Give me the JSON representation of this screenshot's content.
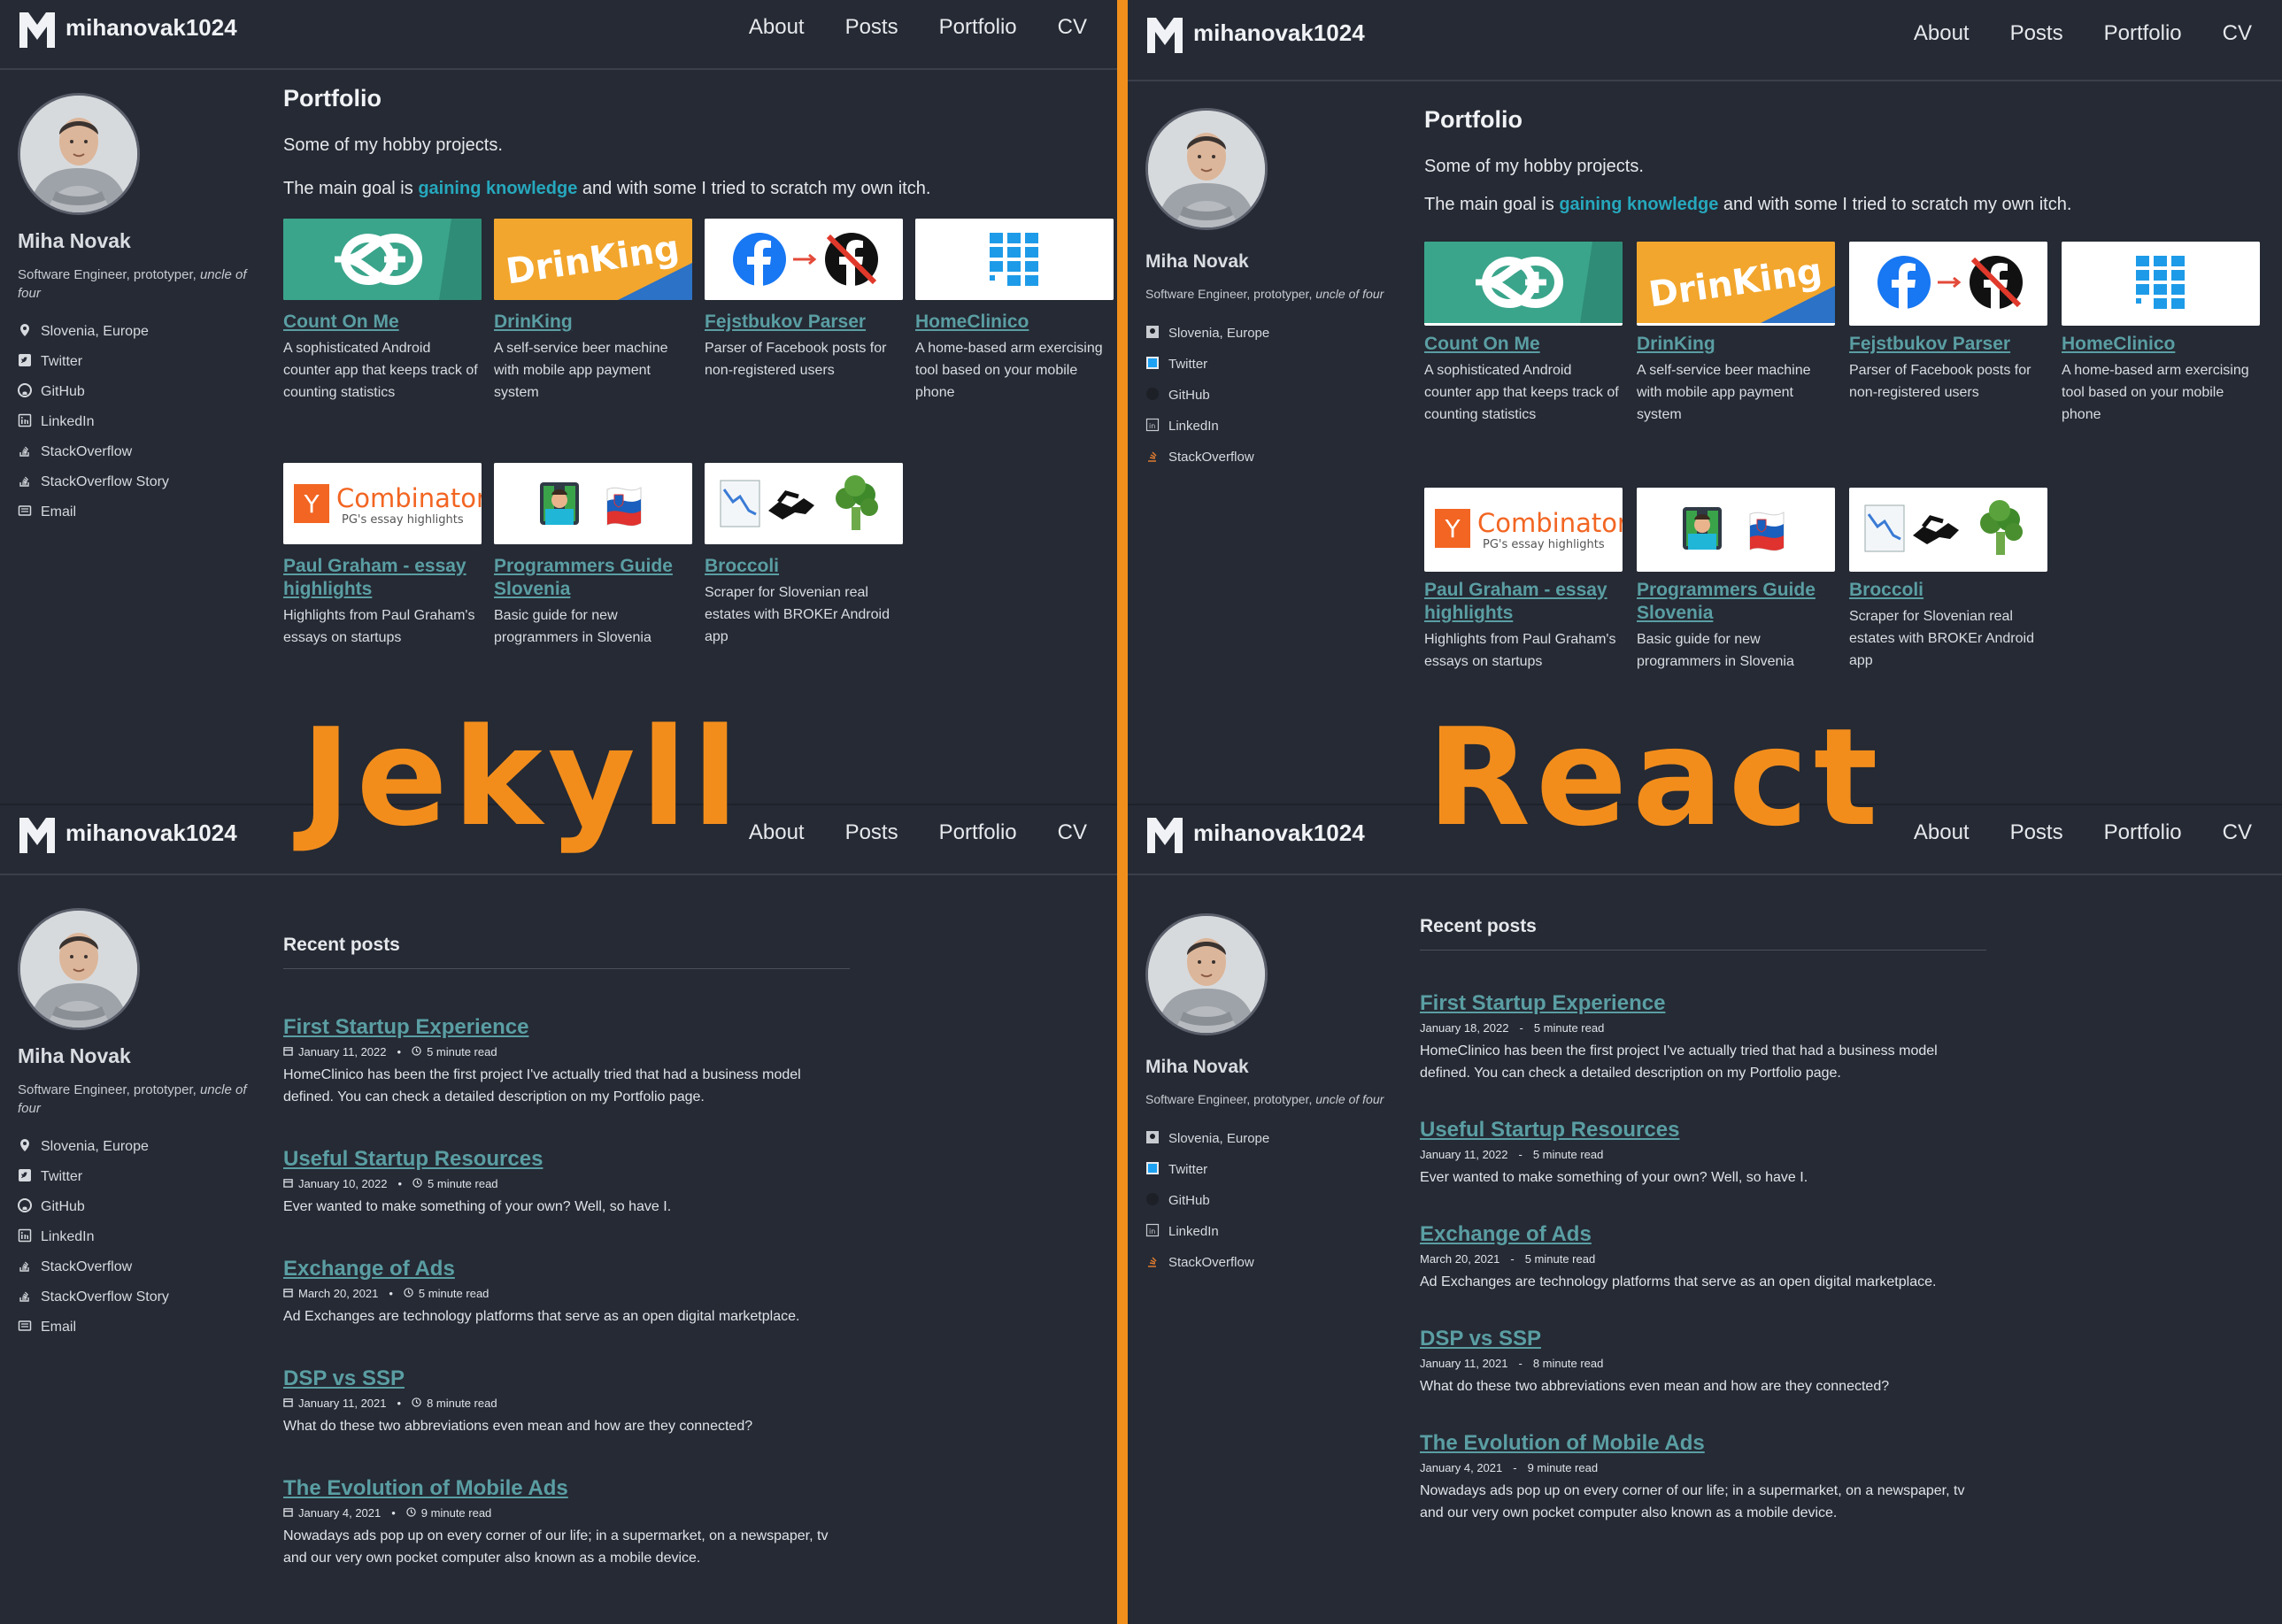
{
  "overlay": {
    "left_label": "Jekyll",
    "right_label": "React"
  },
  "brand": {
    "name": "mihanovak1024"
  },
  "nav": [
    "About",
    "Posts",
    "Portfolio",
    "CV"
  ],
  "profile": {
    "name": "Miha Novak",
    "tagline_prefix": "Software Engineer, prototyper,",
    "tagline_italic": "uncle of four"
  },
  "sidebar_links_jekyll": [
    {
      "label": "Slovenia, Europe",
      "icon": "map-pin-icon"
    },
    {
      "label": "Twitter",
      "icon": "twitter-icon"
    },
    {
      "label": "GitHub",
      "icon": "github-icon"
    },
    {
      "label": "LinkedIn",
      "icon": "linkedin-icon"
    },
    {
      "label": "StackOverflow",
      "icon": "stackoverflow-icon"
    },
    {
      "label": "StackOverflow Story",
      "icon": "stackoverflow-icon"
    },
    {
      "label": "Email",
      "icon": "email-icon"
    }
  ],
  "sidebar_links_react": [
    {
      "label": "Slovenia, Europe",
      "icon": "map-pin-icon"
    },
    {
      "label": "Twitter",
      "icon": "twitter-icon"
    },
    {
      "label": "GitHub",
      "icon": "github-icon"
    },
    {
      "label": "LinkedIn",
      "icon": "linkedin-icon"
    },
    {
      "label": "StackOverflow",
      "icon": "stackoverflow-icon"
    }
  ],
  "portfolio": {
    "title": "Portfolio",
    "intro": "Some of my hobby projects.",
    "goal_prefix": "The main goal is",
    "goal_highlight": "gaining knowledge",
    "goal_suffix": "and with some I tried to scratch my own itch.",
    "projects": [
      {
        "title": "Count On Me",
        "desc": "A sophisticated Android counter app that keeps track of counting statistics",
        "thumb": "count-on-me"
      },
      {
        "title": "DrinKing",
        "desc": "A self-service beer machine with mobile app payment system",
        "thumb": "drinking"
      },
      {
        "title": "Fejstbukov Parser",
        "desc": "Parser of Facebook posts for non-registered users",
        "thumb": "facebook-parser"
      },
      {
        "title": "HomeClinico",
        "desc": "A home-based arm exercising tool based on your mobile phone",
        "thumb": "homeclinico"
      },
      {
        "title": "Paul Graham - essay highlights",
        "desc": "Highlights from Paul Graham's essays on startups",
        "thumb": "ycombinator"
      },
      {
        "title": "Programmers Guide Slovenia",
        "desc": "Basic guide for new programmers in Slovenia",
        "thumb": "programmer-slovenia"
      },
      {
        "title": "Broccoli",
        "desc": "Scraper for Slovenian real estates with BROKEr Android app",
        "thumb": "broccoli"
      }
    ],
    "thumb_text": {
      "drinking": "DrinKing",
      "yc_name": "Combinator",
      "yc_sub": "PG's essay highlights",
      "yc_letter": "Y"
    }
  },
  "posts": {
    "heading": "Recent posts",
    "jekyll": [
      {
        "title": "First Startup Experience",
        "date": "January 11, 2022",
        "read": "5 minute read",
        "excerpt": "HomeClinico has been the first project I've actually tried that had a business model defined. You can check a detailed description on my Portfolio page."
      },
      {
        "title": "Useful Startup Resources",
        "date": "January 10, 2022",
        "read": "5 minute read",
        "excerpt": "Ever wanted to make something of your own? Well, so have I."
      },
      {
        "title": "Exchange of Ads",
        "date": "March 20, 2021",
        "read": "5 minute read",
        "excerpt": "Ad Exchanges are technology platforms that serve as an open digital marketplace."
      },
      {
        "title": "DSP vs SSP",
        "date": "January 11, 2021",
        "read": "8 minute read",
        "excerpt": "What do these two abbreviations even mean and how are they connected?"
      },
      {
        "title": "The Evolution of Mobile Ads",
        "date": "January 4, 2021",
        "read": "9 minute read",
        "excerpt": "Nowadays ads pop up on every corner of our life; in a supermarket, on a newspaper, tv and our very own pocket computer also known as a mobile device."
      }
    ],
    "react": [
      {
        "title": "First Startup Experience",
        "date": "January 18, 2022",
        "read": "5 minute read",
        "excerpt": "HomeClinico has been the first project I've actually tried that had a business model defined. You can check a detailed description on my Portfolio page."
      },
      {
        "title": "Useful Startup Resources",
        "date": "January 11, 2022",
        "read": "5 minute read",
        "excerpt": "Ever wanted to make something of your own? Well, so have I."
      },
      {
        "title": "Exchange of Ads",
        "date": "March 20, 2021",
        "read": "5 minute read",
        "excerpt": "Ad Exchanges are technology platforms that serve as an open digital marketplace."
      },
      {
        "title": "DSP vs SSP",
        "date": "January 11, 2021",
        "read": "8 minute read",
        "excerpt": "What do these two abbreviations even mean and how are they connected?"
      },
      {
        "title": "The Evolution of Mobile Ads",
        "date": "January 4, 2021",
        "read": "9 minute read",
        "excerpt": "Nowadays ads pop up on every corner of our life; in a supermarket, on a newspaper, tv and our very own pocket computer also known as a mobile device."
      }
    ],
    "separator": "•",
    "react_separator": "-"
  },
  "colors": {
    "background": "#252a34",
    "link": "#5a9ea3",
    "highlight": "#26a8bd",
    "accent": "#f28d1c"
  }
}
